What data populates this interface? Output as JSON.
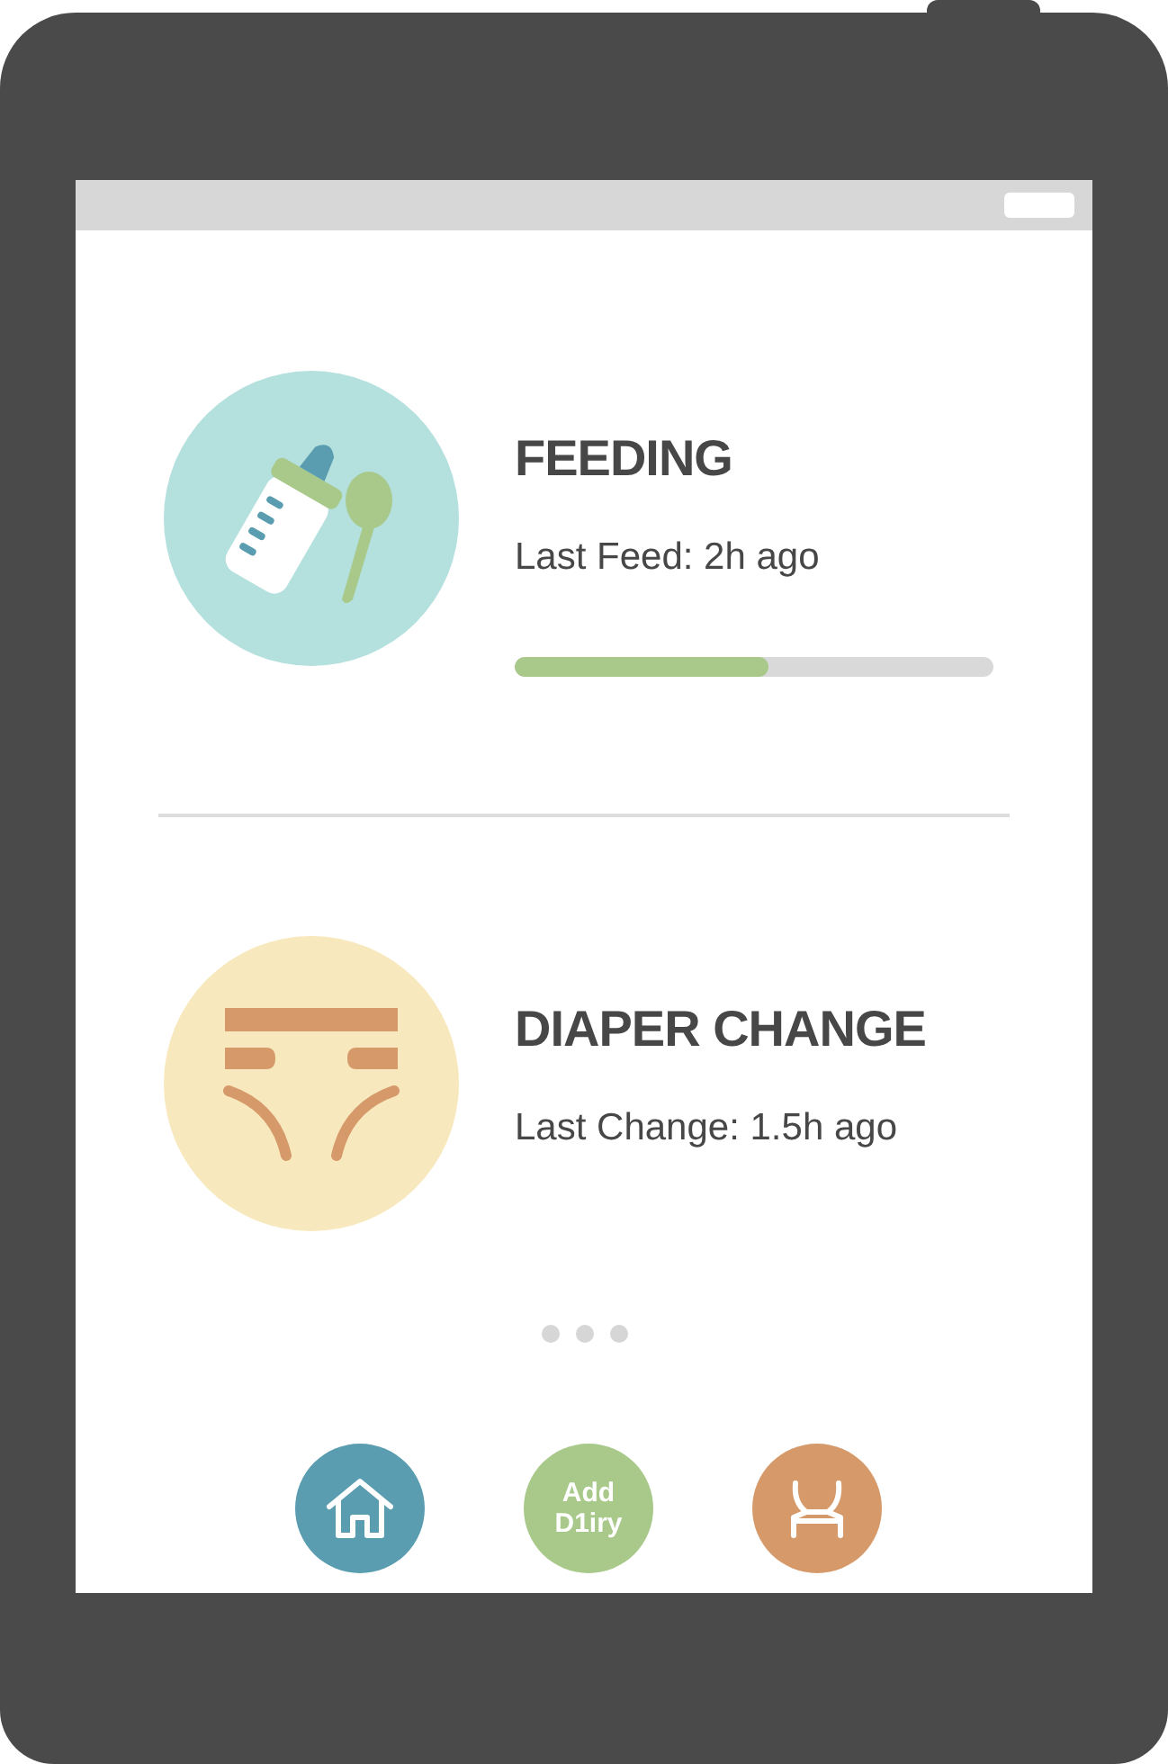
{
  "cards": [
    {
      "kind": "feeding",
      "title": "FEEDING",
      "subtitle": "Last Feed: 2h ago",
      "level": 0.53
    },
    {
      "kind": "diaper",
      "title": "DIAPER CHANGE",
      "subtitle": "Last Change: 1.5h ago"
    }
  ],
  "nav_buttons": [
    {
      "kind": "home"
    },
    {
      "kind": "add",
      "label": "Add D1iry"
    },
    {
      "kind": "seat"
    }
  ]
}
